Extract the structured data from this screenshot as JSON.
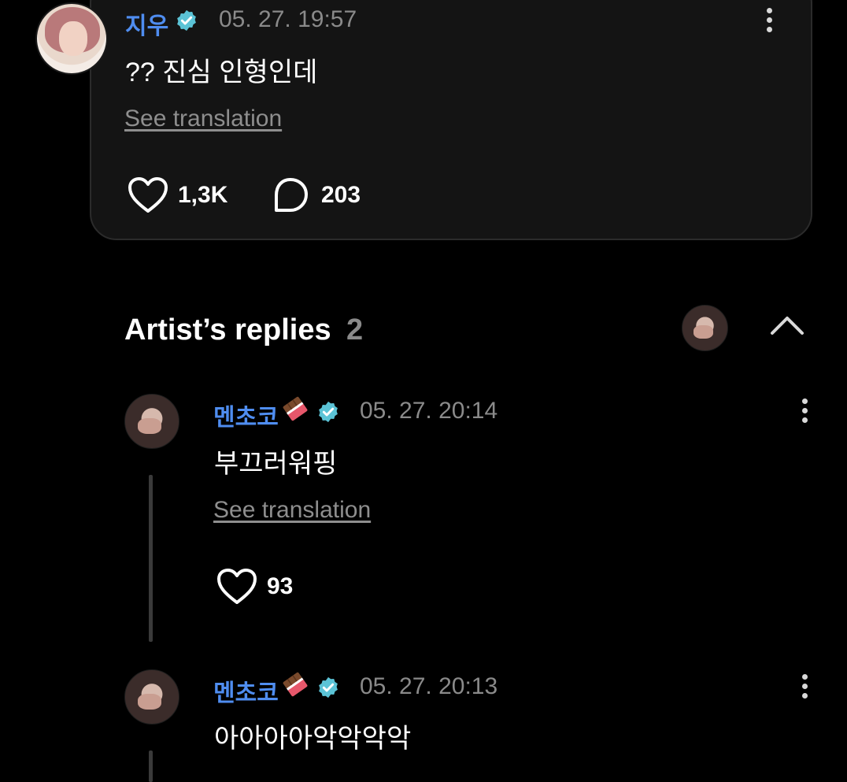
{
  "post": {
    "username": "지우",
    "timestamp": "05. 27. 19:57",
    "text": "?? 진심 인형인데",
    "see_translation": "See translation",
    "likes": "1,3K",
    "comments": "203"
  },
  "artist_replies": {
    "title": "Artist’s replies",
    "count": "2"
  },
  "replies": [
    {
      "username": "멘초코",
      "timestamp": "05. 27. 20:14",
      "text": "부끄러워핑",
      "see_translation": "See translation",
      "likes": "93"
    },
    {
      "username": "멘초코",
      "timestamp": "05. 27. 20:13",
      "text": "아아아아악악악악"
    }
  ],
  "icons": {
    "verified": "verified-badge-icon",
    "heart": "heart-icon",
    "comment": "comment-bubble-icon",
    "more": "more-vertical-icon",
    "collapse": "chevron-up-icon",
    "emoji": "chocolate-bar-emoji"
  },
  "colors": {
    "background": "#000000",
    "card": "#141414",
    "username": "#4f8df0",
    "verified": "#5bc3d6",
    "muted": "#8a8a8a"
  }
}
